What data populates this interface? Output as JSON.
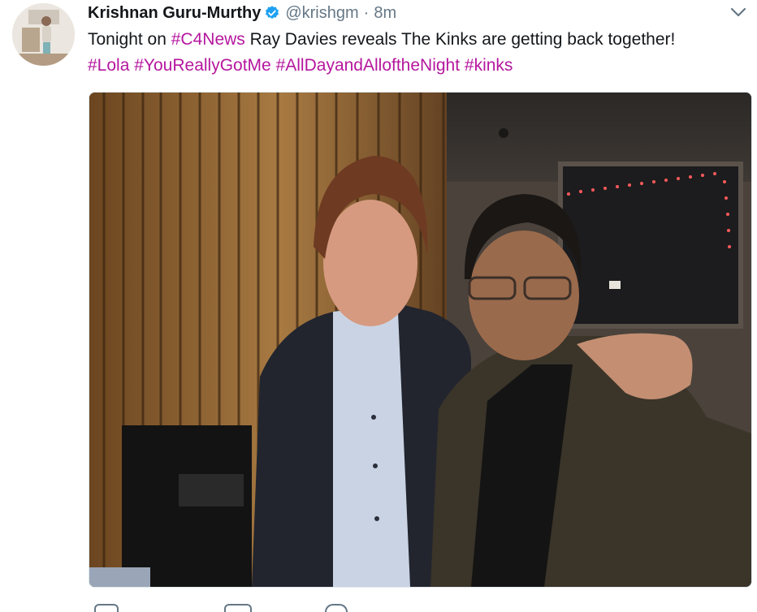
{
  "tweet": {
    "display_name": "Krishnan Guru-Murthy",
    "handle": "@krishgm",
    "separator": "·",
    "time": "8m",
    "text_parts": {
      "p1": "Tonight on ",
      "h1": "#C4News",
      "p2": " Ray Davies reveals The Kinks are getting back together!",
      "h2": "#Lola",
      "h3": "#YouReallyGotMe",
      "h4": "#AllDayandAlloftheNight",
      "h5": "#kinks"
    },
    "icons": {
      "verified": "verified-badge-icon",
      "menu": "chevron-down-icon",
      "reply": "reply-icon",
      "retweet": "retweet-icon",
      "like": "heart-icon"
    },
    "colors": {
      "hashtag": "#b5179e",
      "verified": "#1da1f2",
      "muted": "#657786"
    }
  }
}
